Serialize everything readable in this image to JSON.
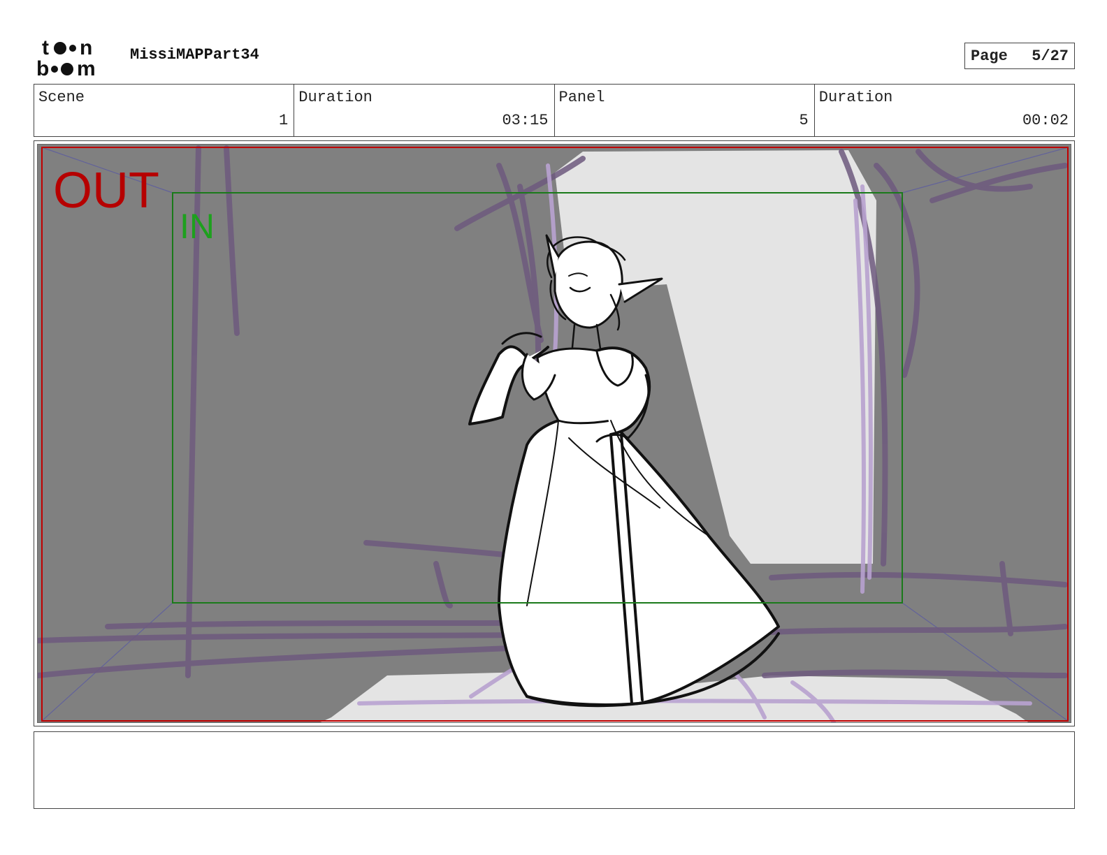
{
  "header": {
    "logo_text": "toon boom",
    "project_title": "MissiMAPPart34",
    "page_label": "Page",
    "page_value": "5/27"
  },
  "info": {
    "scene_label": "Scene",
    "scene_value": "1",
    "scene_duration_label": "Duration",
    "scene_duration_value": "03:15",
    "panel_label": "Panel",
    "panel_value": "5",
    "panel_duration_label": "Duration",
    "panel_duration_value": "00:02"
  },
  "panel": {
    "out_label": "OUT",
    "in_label": "IN",
    "colors": {
      "background": "#808080",
      "light_area": "#e4e4e4",
      "purple_strokes": "#6e5a7e",
      "lavender_strokes": "#b8a2d0",
      "out_frame": "#c00000",
      "in_frame": "#1a7a1a",
      "camera_lines": "#5a5aa0"
    }
  },
  "notes": {
    "text": ""
  }
}
